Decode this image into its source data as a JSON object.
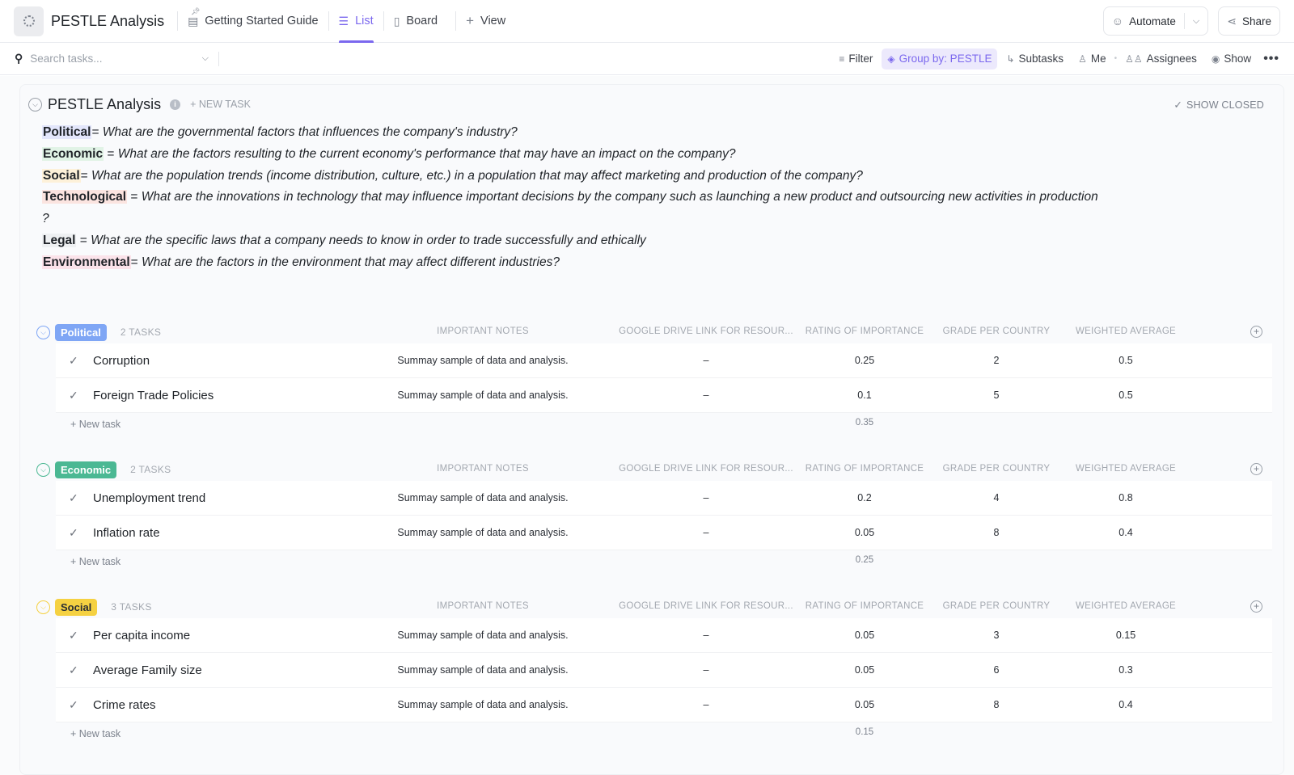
{
  "header": {
    "title": "PESTLE Analysis",
    "tabs": [
      {
        "label": "Getting Started Guide",
        "icon": "doc-icon",
        "pinned": true
      },
      {
        "label": "List",
        "icon": "list-icon",
        "active": true
      },
      {
        "label": "Board",
        "icon": "board-icon"
      },
      {
        "label": "View",
        "icon": "plus-icon"
      }
    ],
    "automate_label": "Automate",
    "share_label": "Share"
  },
  "toolbar": {
    "search_placeholder": "Search tasks...",
    "filter_label": "Filter",
    "group_by_label": "Group by: PESTLE",
    "subtasks_label": "Subtasks",
    "me_label": "Me",
    "assignees_label": "Assignees",
    "show_label": "Show"
  },
  "list": {
    "title": "PESTLE Analysis",
    "new_task_label": "+ NEW TASK",
    "show_closed_label": "SHOW CLOSED",
    "description": [
      {
        "key": "Political",
        "sep": "= ",
        "text": "What are the governmental factors that influences the company's industry?",
        "color": "#e3e6fb"
      },
      {
        "key": "Economic",
        "sep": " = ",
        "text": "What are the factors resulting to the current economy's performance that may have an impact on the company?",
        "color": "#e1f3e6"
      },
      {
        "key": "Social",
        "sep": "= ",
        "text": "What are the population trends (income distribution, culture, etc.) in a population that may affect marketing and production of the company?",
        "color": "#fdf1d9"
      },
      {
        "key": "Technological",
        "sep": " = ",
        "text": "What are the innovations in technology that may influence important decisions by the company such as launching a new product and outsourcing new activities in production ?",
        "color": "#fbe4e0"
      },
      {
        "key": "Legal",
        "sep": " = ",
        "text": "What are the specific laws that a company needs to know in order to trade successfully and ethically",
        "color": "#eef0f2"
      },
      {
        "key": "Environmental",
        "sep": "= ",
        "text": "What are the factors in the environment that may affect different industries?",
        "color": "#fbe3ea"
      }
    ]
  },
  "columns": [
    "IMPORTANT NOTES",
    "GOOGLE DRIVE LINK FOR RESOUR...",
    "RATING OF IMPORTANCE",
    "GRADE PER COUNTRY",
    "WEIGHTED AVERAGE"
  ],
  "groups": [
    {
      "name": "Political",
      "count_label": "2 TASKS",
      "color": "#7fa6f5",
      "tasks": [
        {
          "name": "Corruption",
          "notes": "Summay sample of data and analysis.",
          "drive": "–",
          "rating": "0.25",
          "grade": "2",
          "weighted": "0.5"
        },
        {
          "name": "Foreign Trade Policies",
          "notes": "Summay sample of data and analysis.",
          "drive": "–",
          "rating": "0.1",
          "grade": "5",
          "weighted": "0.5"
        }
      ],
      "new_task_label": "+ New task",
      "rating_sum": "0.35"
    },
    {
      "name": "Economic",
      "count_label": "2 TASKS",
      "color": "#4bb893",
      "tasks": [
        {
          "name": "Unemployment trend",
          "notes": "Summay sample of data and analysis.",
          "drive": "–",
          "rating": "0.2",
          "grade": "4",
          "weighted": "0.8"
        },
        {
          "name": "Inflation rate",
          "notes": "Summay sample of data and analysis.",
          "drive": "–",
          "rating": "0.05",
          "grade": "8",
          "weighted": "0.4"
        }
      ],
      "new_task_label": "+ New task",
      "rating_sum": "0.25"
    },
    {
      "name": "Social",
      "count_label": "3 TASKS",
      "color": "#f5d142",
      "tasks": [
        {
          "name": "Per capita income",
          "notes": "Summay sample of data and analysis.",
          "drive": "–",
          "rating": "0.05",
          "grade": "3",
          "weighted": "0.15"
        },
        {
          "name": "Average Family size",
          "notes": "Summay sample of data and analysis.",
          "drive": "–",
          "rating": "0.05",
          "grade": "6",
          "weighted": "0.3"
        },
        {
          "name": "Crime rates",
          "notes": "Summay sample of data and analysis.",
          "drive": "–",
          "rating": "0.05",
          "grade": "8",
          "weighted": "0.4"
        }
      ],
      "new_task_label": "+ New task",
      "rating_sum": "0.15"
    }
  ]
}
